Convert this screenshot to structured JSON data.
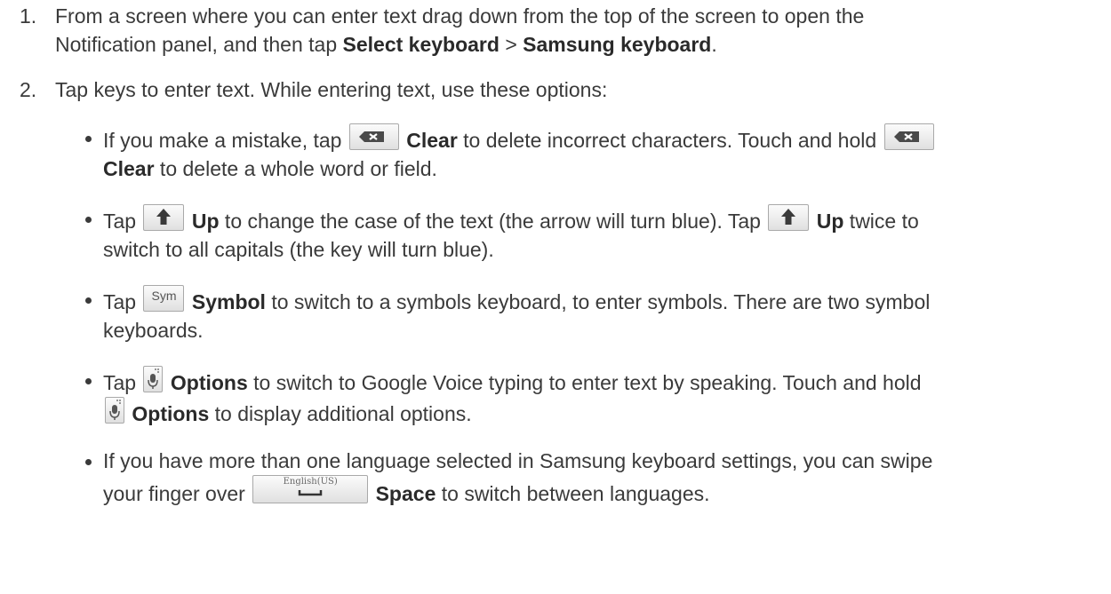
{
  "steps": [
    {
      "num": "1.",
      "line1": "From a screen where you can enter text drag down from the top of the screen to open the",
      "line2_pre": "Notification panel, and then tap ",
      "bold_a": "Select keyboard",
      "sep": " > ",
      "bold_b": "Samsung keyboard",
      "end": "."
    },
    {
      "num": "2.",
      "text": "Tap keys to enter text. While entering text, use these options:"
    }
  ],
  "bullets": {
    "clear": {
      "pre": "If you make a mistake, tap ",
      "label": "Clear",
      "mid": " to delete incorrect characters. Touch and hold ",
      "label2": "Clear",
      "post": " to delete a whole word or field."
    },
    "up": {
      "pre": "Tap ",
      "label": "Up",
      "mid": " to change the case of the text (the arrow will turn blue). Tap ",
      "label2": "Up",
      "mid2": " twice to",
      "line2": "switch to all capitals (the key will turn blue)."
    },
    "symbol": {
      "pre": "Tap ",
      "key_text": "Sym",
      "label": "Symbol",
      "post": " to switch to a symbols keyboard, to enter symbols. There are two symbol",
      "line2": "keyboards."
    },
    "options": {
      "pre": "Tap ",
      "label": "Options",
      "post": " to switch to Google Voice typing to enter text by speaking. Touch and hold",
      "label2": "Options",
      "line2_post": " to display additional options."
    },
    "space": {
      "line1": "If you have more than one language selected in Samsung keyboard settings, you can swipe",
      "pre": "your finger over ",
      "key_text": "English(US)",
      "label": "Space",
      "post": " to switch between languages."
    }
  },
  "icons": {
    "clear": "backspace-icon",
    "up": "shift-arrow-icon",
    "sym": "sym-key-icon",
    "mic": "microphone-icon",
    "space": "space-key-icon"
  }
}
